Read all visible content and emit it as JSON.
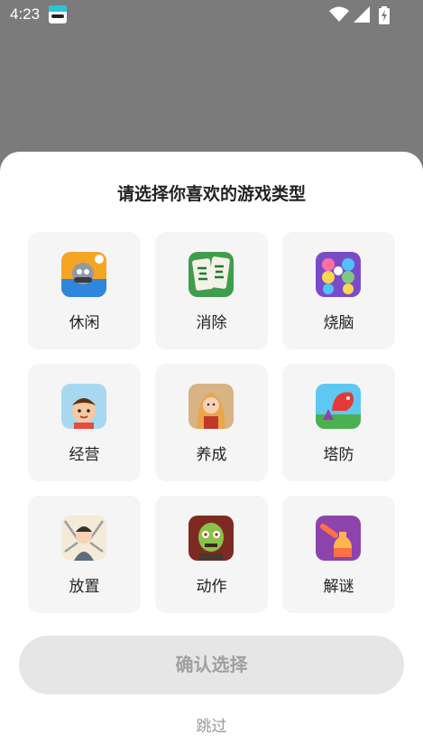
{
  "status_bar": {
    "time": "4:23",
    "app_icon": "app-notification-icon",
    "icons": [
      "wifi-icon",
      "cell-signal-icon",
      "battery-charging-icon"
    ]
  },
  "sheet": {
    "title": "请选择你喜欢的游戏类型",
    "categories": [
      {
        "label": "休闲",
        "icon": "casual-game-icon"
      },
      {
        "label": "消除",
        "icon": "mahjong-match-icon"
      },
      {
        "label": "烧脑",
        "icon": "puzzle-ring-icon"
      },
      {
        "label": "经营",
        "icon": "management-boy-icon"
      },
      {
        "label": "养成",
        "icon": "raising-girl-icon"
      },
      {
        "label": "塔防",
        "icon": "tower-defense-dragon-icon"
      },
      {
        "label": "放置",
        "icon": "idle-swordsman-icon"
      },
      {
        "label": "动作",
        "icon": "zombie-action-icon"
      },
      {
        "label": "解谜",
        "icon": "bottle-pour-icon"
      }
    ],
    "confirm_label": "确认选择",
    "skip_label": "跳过"
  },
  "colors": {
    "overlay": "#7b7b7b",
    "card_bg": "#f5f5f5",
    "button_bg": "#e6e6e6",
    "button_text": "#a0a0a0"
  }
}
